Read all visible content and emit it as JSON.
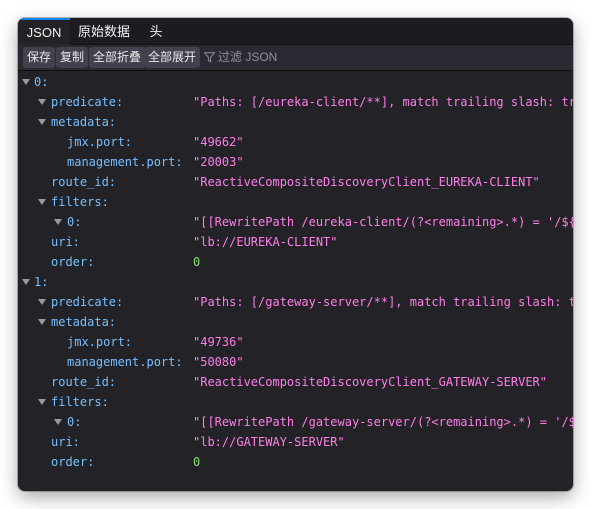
{
  "tabs": [
    {
      "label": "JSON",
      "active": true
    },
    {
      "label": "原始数据",
      "active": false
    },
    {
      "label": "头",
      "active": false
    }
  ],
  "toolbar": {
    "save_label": "保存",
    "copy_label": "复制",
    "collapse_all_label": "全部折叠",
    "expand_all_label": "全部展开",
    "filter_placeholder": "过滤 JSON"
  },
  "colors": {
    "key": "#75bfff",
    "string": "#ff7de9",
    "number": "#86de74",
    "accent": "#0a84ff"
  },
  "rows": [
    {
      "key": "0:",
      "depth": 0,
      "expander": true,
      "value": null,
      "type": null
    },
    {
      "key": "predicate:",
      "depth": 1,
      "expander": true,
      "value": "\"Paths: [/eureka-client/**], match trailing slash: true\"",
      "type": "string"
    },
    {
      "key": "metadata:",
      "depth": 1,
      "expander": true,
      "value": null,
      "type": null
    },
    {
      "key": "jmx.port:",
      "depth": 2,
      "expander": false,
      "value": "\"49662\"",
      "type": "string"
    },
    {
      "key": "management.port:",
      "depth": 2,
      "expander": false,
      "value": "\"20003\"",
      "type": "string"
    },
    {
      "key": "route_id:",
      "depth": 1,
      "expander": false,
      "value": "\"ReactiveCompositeDiscoveryClient_EUREKA-CLIENT\"",
      "type": "string"
    },
    {
      "key": "filters:",
      "depth": 1,
      "expander": true,
      "value": null,
      "type": null
    },
    {
      "key": "0:",
      "depth": 2,
      "expander": true,
      "value": "\"[[RewritePath /eureka-client/(?<remaining>.*) = '/${remaining}']]\"",
      "type": "string"
    },
    {
      "key": "uri:",
      "depth": 1,
      "expander": false,
      "value": "\"lb://EUREKA-CLIENT\"",
      "type": "string"
    },
    {
      "key": "order:",
      "depth": 1,
      "expander": false,
      "value": "0",
      "type": "number"
    },
    {
      "key": "1:",
      "depth": 0,
      "expander": true,
      "value": null,
      "type": null
    },
    {
      "key": "predicate:",
      "depth": 1,
      "expander": true,
      "value": "\"Paths: [/gateway-server/**], match trailing slash: true\"",
      "type": "string"
    },
    {
      "key": "metadata:",
      "depth": 1,
      "expander": true,
      "value": null,
      "type": null
    },
    {
      "key": "jmx.port:",
      "depth": 2,
      "expander": false,
      "value": "\"49736\"",
      "type": "string"
    },
    {
      "key": "management.port:",
      "depth": 2,
      "expander": false,
      "value": "\"50080\"",
      "type": "string"
    },
    {
      "key": "route_id:",
      "depth": 1,
      "expander": false,
      "value": "\"ReactiveCompositeDiscoveryClient_GATEWAY-SERVER\"",
      "type": "string"
    },
    {
      "key": "filters:",
      "depth": 1,
      "expander": true,
      "value": null,
      "type": null
    },
    {
      "key": "0:",
      "depth": 2,
      "expander": true,
      "value": "\"[[RewritePath /gateway-server/(?<remaining>.*) = '/${remaining}']]\"",
      "type": "string"
    },
    {
      "key": "uri:",
      "depth": 1,
      "expander": false,
      "value": "\"lb://GATEWAY-SERVER\"",
      "type": "string"
    },
    {
      "key": "order:",
      "depth": 1,
      "expander": false,
      "value": "0",
      "type": "number"
    }
  ]
}
